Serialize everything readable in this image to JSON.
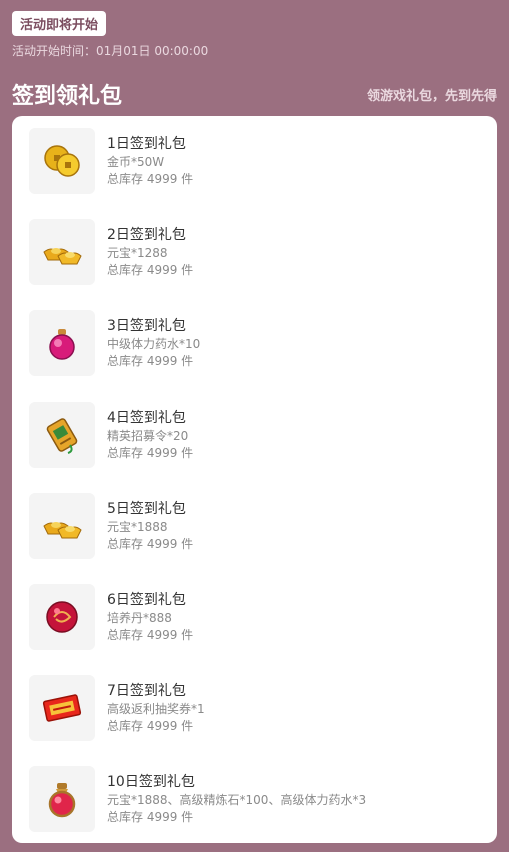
{
  "header": {
    "badge": "活动即将开始",
    "start_time": "活动开始时间：01月01日 00:00:00",
    "title": "签到领礼包",
    "slogan": "领游戏礼包，先到先得"
  },
  "items": [
    {
      "name": "1日签到礼包",
      "reward": "金币*50W",
      "stock": "总库存 4999 件",
      "icon": "gold-coins-icon"
    },
    {
      "name": "2日签到礼包",
      "reward": "元宝*1288",
      "stock": "总库存 4999 件",
      "icon": "gold-ingot-icon"
    },
    {
      "name": "3日签到礼包",
      "reward": "中级体力药水*10",
      "stock": "总库存 4999 件",
      "icon": "potion-icon"
    },
    {
      "name": "4日签到礼包",
      "reward": "精英招募令*20",
      "stock": "总库存 4999 件",
      "icon": "recruit-token-icon"
    },
    {
      "name": "5日签到礼包",
      "reward": "元宝*1888",
      "stock": "总库存 4999 件",
      "icon": "gold-ingot-icon"
    },
    {
      "name": "6日签到礼包",
      "reward": "培养丹*888",
      "stock": "总库存 4999 件",
      "icon": "pill-orb-icon"
    },
    {
      "name": "7日签到礼包",
      "reward": "高级返利抽奖券*1",
      "stock": "总库存 4999 件",
      "icon": "lottery-ticket-icon"
    },
    {
      "name": "10日签到礼包",
      "reward": "元宝*1888、高级精炼石*100、高级体力药水*3",
      "stock": "总库存 4999 件",
      "icon": "advanced-potion-icon"
    }
  ]
}
